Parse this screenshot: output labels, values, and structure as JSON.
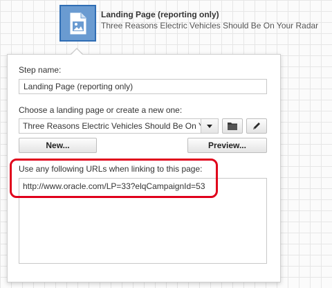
{
  "step": {
    "title": "Landing Page (reporting only)",
    "subtitle": "Three Reasons Electric Vehicles Should Be On Your Radar",
    "icon": "landing-page-icon"
  },
  "panel": {
    "step_name_label": "Step name:",
    "step_name_value": "Landing Page (reporting only)",
    "landing_page_label": "Choose a landing page or create a new one:",
    "landing_page_selected": "Three Reasons Electric Vehicles Should Be On Your Radar",
    "folder_icon": "folder-icon",
    "edit_icon": "pencil-icon",
    "new_button": "New...",
    "preview_button": "Preview...",
    "urls_label": "Use any following URLs when linking to this page:",
    "url_value": "http://www.oracle.com/LP=33?elqCampaignId=53"
  },
  "colors": {
    "node_fill": "#6a9bd1",
    "node_border": "#2f6db4",
    "highlight": "#e0001b"
  }
}
